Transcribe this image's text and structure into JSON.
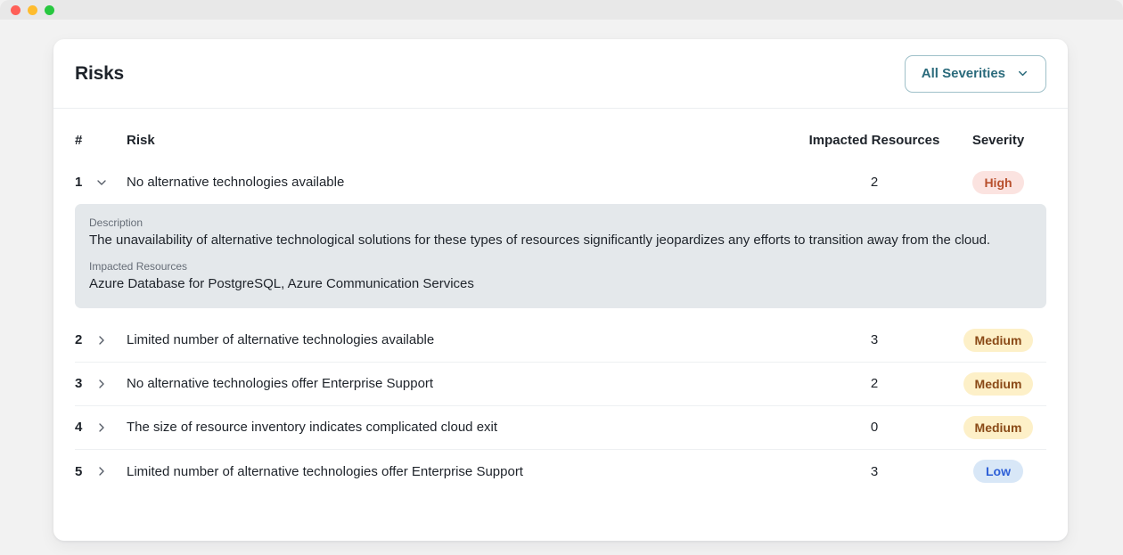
{
  "window": {
    "traffic_lights": [
      {
        "name": "close-button",
        "color": "#ff5f57"
      },
      {
        "name": "minimize-button",
        "color": "#febc2e"
      },
      {
        "name": "maximize-button",
        "color": "#28c840"
      }
    ]
  },
  "card": {
    "title": "Risks",
    "filter": {
      "label": "All Severities",
      "icon": "chevron-down-icon",
      "accent_color": "#2b6b7c",
      "border_color": "#9fc0c9"
    }
  },
  "table": {
    "columns": {
      "number": "#",
      "risk": "Risk",
      "impacted_resources": "Impacted Resources",
      "severity": "Severity"
    },
    "detail_labels": {
      "description": "Description",
      "impacted_resources": "Impacted Resources"
    },
    "rows": [
      {
        "number": "1",
        "risk": "No alternative technologies available",
        "impacted": "2",
        "severity": "High",
        "severity_class": "high",
        "expanded": true,
        "chevron": "chevron-down-icon",
        "detail": {
          "description": "The unavailability of alternative technological solutions for these types of resources significantly jeopardizes any efforts to transition away from the cloud.",
          "impacted_resources": "Azure Database for PostgreSQL, Azure Communication Services"
        }
      },
      {
        "number": "2",
        "risk": "Limited number of alternative technologies available",
        "impacted": "3",
        "severity": "Medium",
        "severity_class": "medium",
        "expanded": false,
        "chevron": "chevron-right-icon"
      },
      {
        "number": "3",
        "risk": "No alternative technologies offer Enterprise Support",
        "impacted": "2",
        "severity": "Medium",
        "severity_class": "medium",
        "expanded": false,
        "chevron": "chevron-right-icon"
      },
      {
        "number": "4",
        "risk": "The size of resource inventory indicates complicated cloud exit",
        "impacted": "0",
        "severity": "Medium",
        "severity_class": "medium",
        "expanded": false,
        "chevron": "chevron-right-icon"
      },
      {
        "number": "5",
        "risk": "Limited number of alternative technologies offer Enterprise Support",
        "impacted": "3",
        "severity": "Low",
        "severity_class": "low",
        "expanded": false,
        "chevron": "chevron-right-icon"
      }
    ]
  },
  "colors": {
    "page_background": "#f2f2f2",
    "card_background": "#ffffff",
    "detail_panel_background": "#e4e8eb",
    "badge_high_bg": "#fbe3e0",
    "badge_high_fg": "#b8502d",
    "badge_medium_bg": "#fdf0c8",
    "badge_medium_fg": "#8a4a17",
    "badge_low_bg": "#d8e7f7",
    "badge_low_fg": "#2d5fd7"
  }
}
